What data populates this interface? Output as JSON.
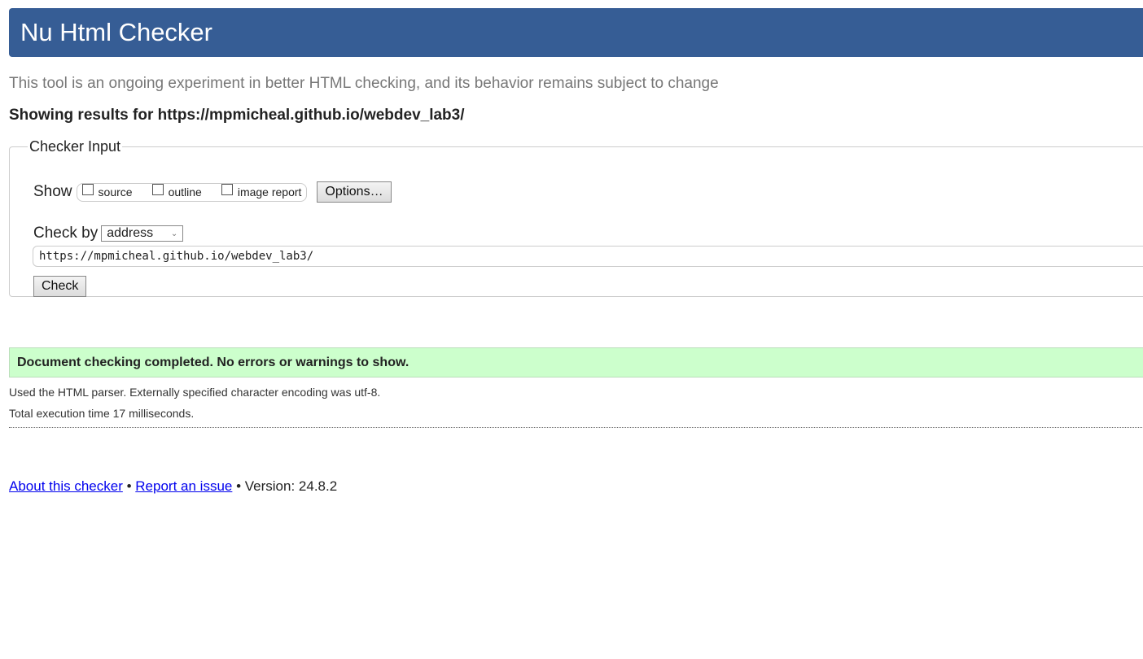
{
  "header": {
    "title": "Nu Html Checker"
  },
  "subtitle": "This tool is an ongoing experiment in better HTML checking, and its behavior remains subject to change",
  "showing": "Showing results for https://mpmicheal.github.io/webdev_lab3/",
  "checker_input": {
    "legend": "Checker Input",
    "show_label": "Show",
    "options": [
      {
        "label": "source",
        "checked": false
      },
      {
        "label": "outline",
        "checked": false
      },
      {
        "label": "image report",
        "checked": false
      }
    ],
    "options_button": "Options…",
    "check_by_label": "Check by",
    "check_by_value": "address",
    "url_value": "https://mpmicheal.github.io/webdev_lab3/",
    "check_button": "Check"
  },
  "result": {
    "message": "Document checking completed. No errors or warnings to show.",
    "parser_info": "Used the HTML parser. Externally specified character encoding was utf-8.",
    "execution_time": "Total execution time 17 milliseconds."
  },
  "footer": {
    "about": "About this checker",
    "sep": "•",
    "report": "Report an issue",
    "version": "• Version: 24.8.2"
  },
  "colors": {
    "header_bg": "#365d95",
    "success_bg": "#ccffcc",
    "link": "#0000ee"
  }
}
